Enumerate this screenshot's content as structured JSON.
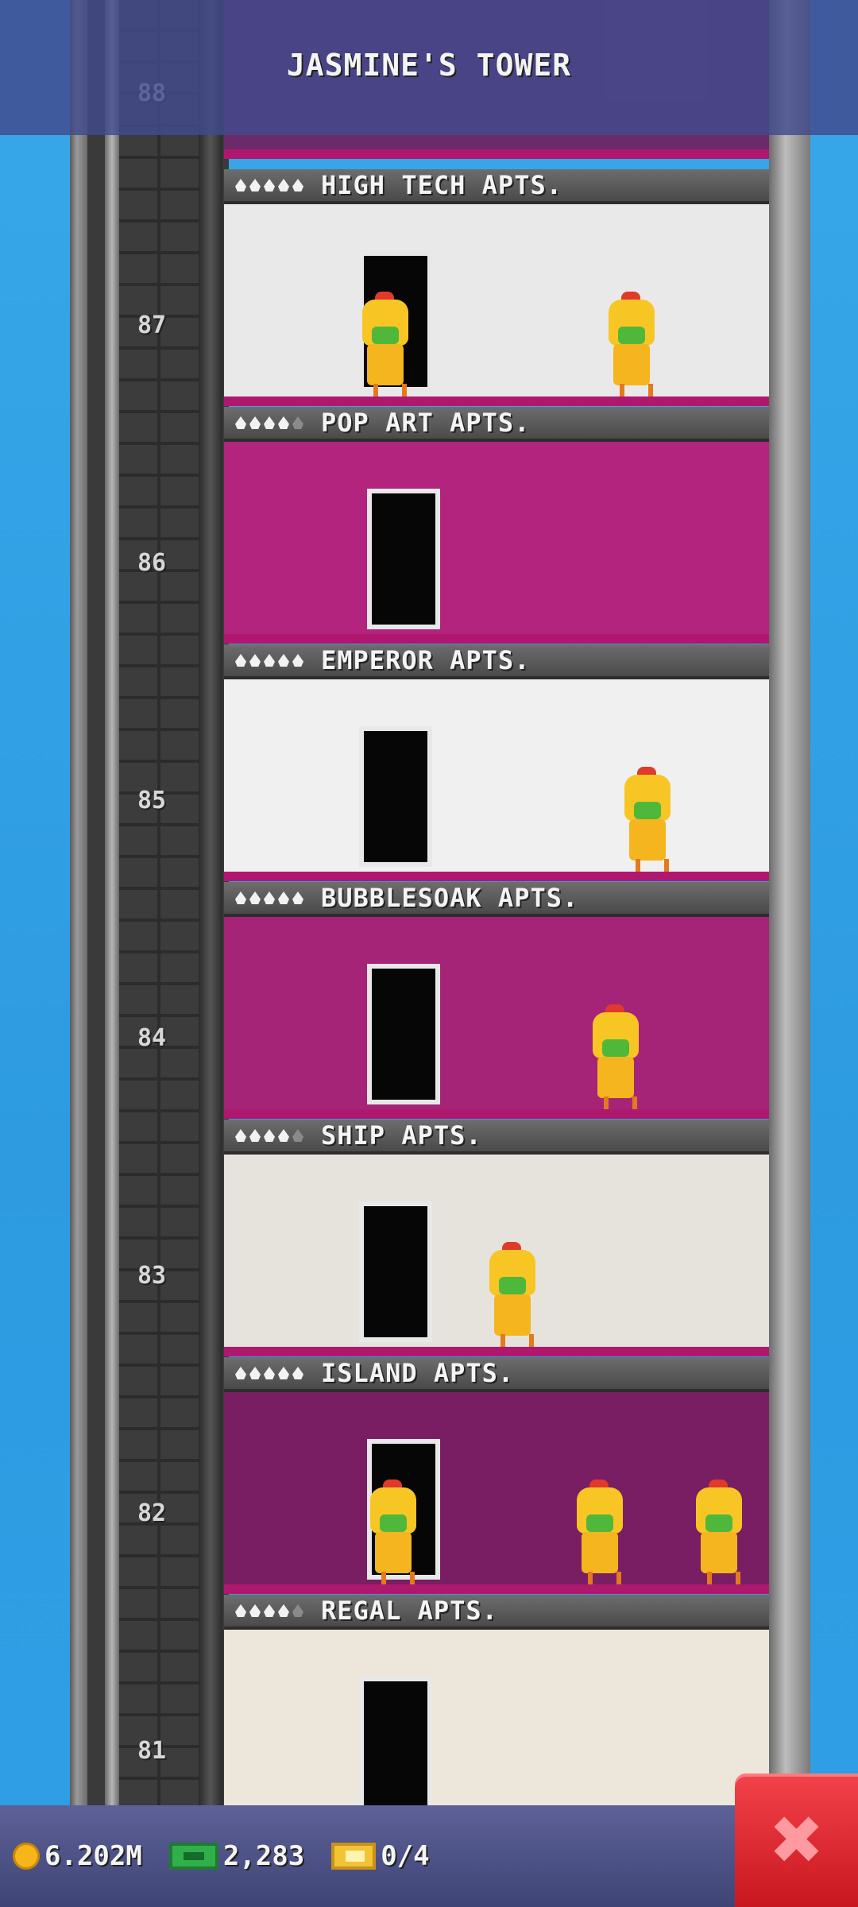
{
  "header": {
    "title": "JASMINE'S TOWER",
    "top_floor_number": "88"
  },
  "floors": [
    {
      "number": "87",
      "name": "HIGH TECH APTS.",
      "stars_on": 5,
      "stars_total": 5,
      "residents": 2,
      "wall": "#e9e9e9"
    },
    {
      "number": "86",
      "name": "POP ART APTS.",
      "stars_on": 4,
      "stars_total": 5,
      "residents": 0,
      "wall": "#b2247e"
    },
    {
      "number": "85",
      "name": "EMPEROR APTS.",
      "stars_on": 5,
      "stars_total": 5,
      "residents": 1,
      "wall": "#f0f0f0"
    },
    {
      "number": "84",
      "name": "BUBBLESOAK APTS.",
      "stars_on": 5,
      "stars_total": 5,
      "residents": 1,
      "wall": "#a52477"
    },
    {
      "number": "83",
      "name": "SHIP APTS.",
      "stars_on": 4,
      "stars_total": 5,
      "residents": 1,
      "wall": "#e6e3dc"
    },
    {
      "number": "82",
      "name": "ISLAND APTS.",
      "stars_on": 5,
      "stars_total": 5,
      "residents": 3,
      "wall": "#7a1e63"
    },
    {
      "number": "81",
      "name": "REGAL APTS.",
      "stars_on": 4,
      "stars_total": 5,
      "residents": 0,
      "wall": "#ece7da"
    }
  ],
  "status_bar": {
    "coins": "6.202M",
    "tower_bux": "2,283",
    "tickets": "0/4"
  },
  "icons": {
    "coin": "coin-icon",
    "bux": "bux-icon",
    "ticket": "ticket-icon",
    "close": "close-icon"
  },
  "colors": {
    "sky": "#2e9be0",
    "close_button": "#e3222b",
    "resident": "#f7c625"
  }
}
